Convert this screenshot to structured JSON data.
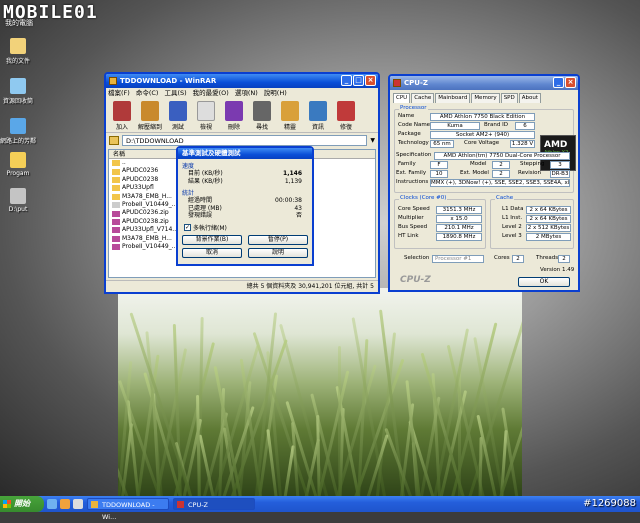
{
  "watermark": {
    "logo": "MOBILE01",
    "id": "#1269088",
    "logo_sub": "我的電腦"
  },
  "desktop": {
    "icons": [
      {
        "label": "我的文件",
        "color": "#f2d27a"
      },
      {
        "label": "資源回收筒",
        "color": "#8fc9f0"
      },
      {
        "label": "網路上的芳鄰",
        "color": "#5aa7e8"
      },
      {
        "label": "Progam",
        "color": "#f5cf57"
      },
      {
        "label": "D:\\put",
        "color": "#c4c4c4"
      }
    ]
  },
  "winrar": {
    "title": "TDDOWNLOAD - WinRAR",
    "menu": [
      "檔案(F)",
      "命令(C)",
      "工具(S)",
      "我的最愛(O)",
      "選項(N)",
      "說明(H)"
    ],
    "tools": [
      {
        "label": "加入",
        "color": "#b03a3a"
      },
      {
        "label": "解壓縮到",
        "color": "#c98a2d"
      },
      {
        "label": "測試",
        "color": "#3a5fc0"
      },
      {
        "label": "檢視",
        "color": "#ddd"
      },
      {
        "label": "刪除",
        "color": "#7b3ab0"
      },
      {
        "label": "尋找",
        "color": "#666"
      },
      {
        "label": "精靈",
        "color": "#d9a03a"
      },
      {
        "label": "資訊",
        "color": "#3a7ac0"
      },
      {
        "label": "修復",
        "color": "#c03a3a"
      }
    ],
    "path": "D:\\TDDOWNLOAD",
    "header": "名稱",
    "files": [
      {
        "name": "..",
        "type": "folder"
      },
      {
        "name": "APUDC0236",
        "type": "folder"
      },
      {
        "name": "APUDC0238",
        "type": "folder"
      },
      {
        "name": "APU33Upfl",
        "type": "folder"
      },
      {
        "name": "M3A78_EMB_H...",
        "type": "folder"
      },
      {
        "name": "ProbeII_V10449_...",
        "type": "file"
      },
      {
        "name": "APUDC0236.zip",
        "type": "archive"
      },
      {
        "name": "APUDC0238.zip",
        "type": "archive"
      },
      {
        "name": "APU33Upfl_V714...",
        "type": "archive"
      },
      {
        "name": "M3A78_EMB_H...",
        "type": "archive"
      },
      {
        "name": "ProbeII_V10449_...",
        "type": "archive"
      }
    ],
    "status": "總共 5 個資料夾及 30,941,201 位元組, 共計 5"
  },
  "bench": {
    "title": "基準測試及硬體測試",
    "speed_label": "速度",
    "current_label": "目前 (KB/秒)",
    "current": "1,146",
    "result_label": "結果 (KB/秒)",
    "result": "1,139",
    "stats_label": "統計",
    "elapsed_label": "經過時間",
    "elapsed": "00:00:38",
    "processed_label": "已處理 (MB)",
    "processed": "43",
    "errors_label": "發現錯誤",
    "errors": "否",
    "multithread_label": "多執行緒(M)",
    "btn_bg": "背景作業(B)",
    "btn_pause": "暫停(P)",
    "btn_cancel": "取消",
    "btn_help": "說明"
  },
  "cpuz": {
    "title": "CPU-Z",
    "tabs": [
      "CPU",
      "Cache",
      "Mainboard",
      "Memory",
      "SPD",
      "About"
    ],
    "processor": "Processor",
    "name_l": "Name",
    "name": "AMD Athlon 7750 Black Edition",
    "code_l": "Code Name",
    "code": "Kuma",
    "brand_l": "Brand ID",
    "brand": "6",
    "package_l": "Package",
    "package": "Socket AM2+ (940)",
    "tech_l": "Technology",
    "tech": "65 nm",
    "volt_l": "Core Voltage",
    "volt": "1.328 V",
    "spec_l": "Specification",
    "spec": "AMD Athlon(tm) 7750 Dual-Core Processor",
    "family_l": "Family",
    "family": "F",
    "model_l": "Model",
    "model": "2",
    "step_l": "Stepping",
    "step": "3",
    "extfam_l": "Ext. Family",
    "extfam": "10",
    "extmod_l": "Ext. Model",
    "extmod": "2",
    "rev_l": "Revision",
    "rev": "DR-B3",
    "instr_l": "Instructions",
    "instr": "MMX (+), 3DNow! (+), SSE, SSE2, SSE3, SSE4A, x86-64",
    "clocks": "Clocks (Core #0)",
    "cs_l": "Core Speed",
    "cs": "3151.3 MHz",
    "mul_l": "Multiplier",
    "mul": "x 15.0",
    "bus_l": "Bus Speed",
    "bus": "210.1 MHz",
    "ht_l": "HT Link",
    "ht": "1890.8 MHz",
    "cache": "Cache",
    "l1d_l": "L1 Data",
    "l1d": "2 x 64 KBytes",
    "l1i_l": "L1 Inst.",
    "l1i": "2 x 64 KBytes",
    "l2_l": "Level 2",
    "l2": "2 x 512 KBytes",
    "l3_l": "Level 3",
    "l3": "2 MBytes",
    "sel_l": "Selection",
    "sel": "Processor #1",
    "cores_l": "Cores",
    "cores": "2",
    "thr_l": "Threads",
    "thr": "2",
    "version": "Version 1.49",
    "brand_mark": "CPU-Z",
    "ok": "OK",
    "amd_line1": "AMD",
    "amd_line2": "Athlon X2"
  },
  "taskbar": {
    "start": "開始",
    "tasks": [
      "TDDOWNLOAD - Wi...",
      "CPU-Z"
    ]
  }
}
